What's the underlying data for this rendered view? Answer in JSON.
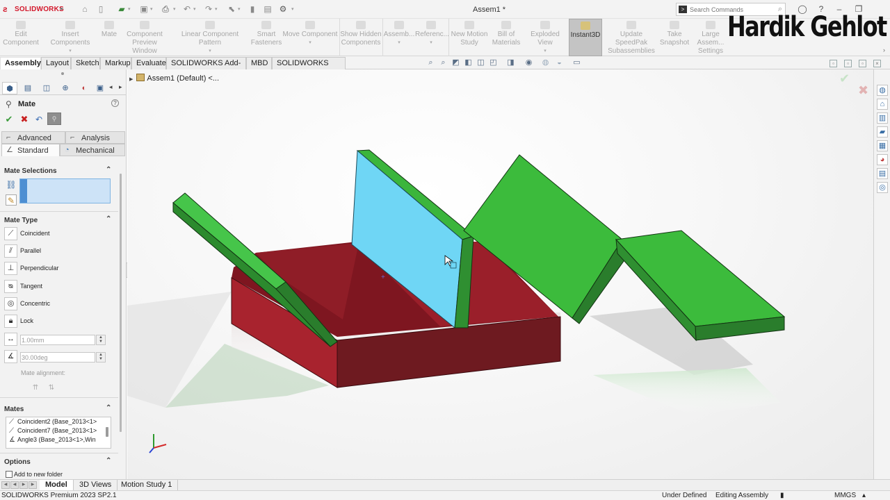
{
  "app": {
    "name": "SOLIDWORKS",
    "document_title": "Assem1 *"
  },
  "search": {
    "placeholder": "Search Commands"
  },
  "command_manager": [
    {
      "label": "Edit Component",
      "icon": "edit-component-icon"
    },
    {
      "label": "Insert Components",
      "icon": "insert-components-icon"
    },
    {
      "label": "Mate",
      "icon": "mate-icon"
    },
    {
      "label": "Component Preview Window",
      "icon": "preview-window-icon"
    },
    {
      "label": "Linear Component Pattern",
      "icon": "linear-pattern-icon"
    },
    {
      "label": "Smart Fasteners",
      "icon": "smart-fasteners-icon"
    },
    {
      "label": "Move Component",
      "icon": "move-component-icon"
    },
    {
      "label": "Show Hidden Components",
      "icon": "show-hidden-icon"
    },
    {
      "label": "Assemb...",
      "icon": "assembly-features-icon"
    },
    {
      "label": "Referenc...",
      "icon": "reference-geometry-icon"
    },
    {
      "label": "New Motion Study",
      "icon": "motion-study-icon"
    },
    {
      "label": "Bill of Materials",
      "icon": "bom-icon"
    },
    {
      "label": "Exploded View",
      "icon": "exploded-view-icon"
    },
    {
      "label": "Instant3D",
      "icon": "instant3d-icon"
    },
    {
      "label": "Update SpeedPak Subassemblies",
      "icon": "speedpak-icon"
    },
    {
      "label": "Take Snapshot",
      "icon": "snapshot-icon"
    },
    {
      "label": "Large Assem... Settings",
      "icon": "large-assembly-icon"
    }
  ],
  "tabs": [
    "Assembly",
    "Layout",
    "Sketch",
    "Markup",
    "Evaluate",
    "SOLIDWORKS Add-Ins",
    "MBD",
    "SOLIDWORKS CAM"
  ],
  "property_manager": {
    "title": "Mate",
    "subtabs": {
      "advanced": "Advanced",
      "analysis": "Analysis",
      "standard": "Standard",
      "mechanical": "Mechanical"
    },
    "mate_selections": {
      "header": "Mate Selections"
    },
    "mate_type": {
      "header": "Mate Type",
      "options": [
        {
          "label": "Coincident",
          "icon": "coincident-icon"
        },
        {
          "label": "Parallel",
          "icon": "parallel-icon"
        },
        {
          "label": "Perpendicular",
          "icon": "perpendicular-icon"
        },
        {
          "label": "Tangent",
          "icon": "tangent-icon"
        },
        {
          "label": "Concentric",
          "icon": "concentric-icon"
        },
        {
          "label": "Lock",
          "icon": "lock-icon"
        }
      ],
      "distance_value": "1.00mm",
      "angle_value": "30.00deg",
      "alignment_label": "Mate alignment:"
    },
    "mates": {
      "header": "Mates",
      "items": [
        "Coincident2 (Base_2013<1>",
        "Coincident7 (Base_2013<1>",
        "Angle3 (Base_2013<1>,Win"
      ]
    },
    "options": {
      "header": "Options",
      "add_to_folder": "Add to new folder"
    }
  },
  "feature_tree": {
    "root_label": "Assem1 (Default) <..."
  },
  "watermark": "Hardik Gehlot",
  "bottom_tabs": [
    "Model",
    "3D Views",
    "Motion Study 1"
  ],
  "status_bar": {
    "product": "SOLIDWORKS Premium 2023 SP2.1",
    "state": "Under Defined",
    "mode": "Editing Assembly",
    "units": "MMGS"
  },
  "colors": {
    "base_box": "#8b1c24",
    "green_panels": "#3cbb3c",
    "selected_panel": "#6fd6f5",
    "selection_box": "#cde3f7"
  }
}
